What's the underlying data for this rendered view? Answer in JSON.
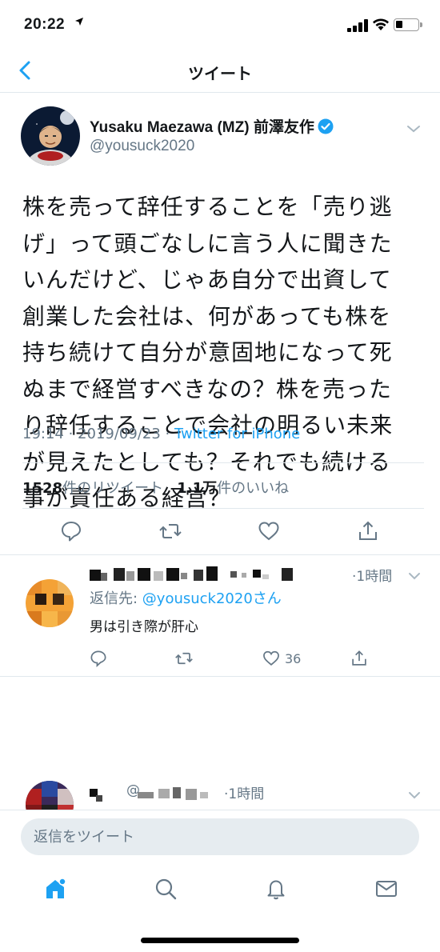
{
  "status_bar": {
    "time": "20:22",
    "location_icon": "location-arrow-icon"
  },
  "nav": {
    "title": "ツイート",
    "back_icon": "chevron-left-icon"
  },
  "tweet": {
    "author_name": "Yusaku Maezawa (MZ) 前澤友作",
    "author_handle": "@yousuck2020",
    "text_lines": [
      "株を売って辞任することを「売り逃",
      "げ」って頭ごなしに言う人に聞きた",
      "いんだけど、じゃあ自分で出資して",
      "創業した会社は、何があっても株を",
      "持ち続けて自分が意固地になって死",
      "ぬまで経営すべきなの？株を売った",
      "り辞任することで会社の明るい未来",
      "が見えたとしても？それでも続ける",
      "事が責任ある経営？"
    ],
    "time": "19:14",
    "date": "2019/09/23",
    "separator": " · ",
    "source": "Twitter for iPhone",
    "retweets_count": "1528",
    "retweets_label": "件のリツイート",
    "likes_count": "1.1万",
    "likes_label": "件のいいね"
  },
  "reply1": {
    "time": "·1時間",
    "reply_to_prefix": "返信先: ",
    "reply_to_mention": "@yousuck2020さん",
    "text": "男は引き際が肝心",
    "like_count": "36"
  },
  "reply2": {
    "time": "·1時間",
    "handle_partial": "@"
  },
  "compose": {
    "placeholder": "返信をツイート"
  },
  "colors": {
    "accent": "#1da1f2",
    "secondary_text": "#657786",
    "divider": "#e1e8ed"
  }
}
